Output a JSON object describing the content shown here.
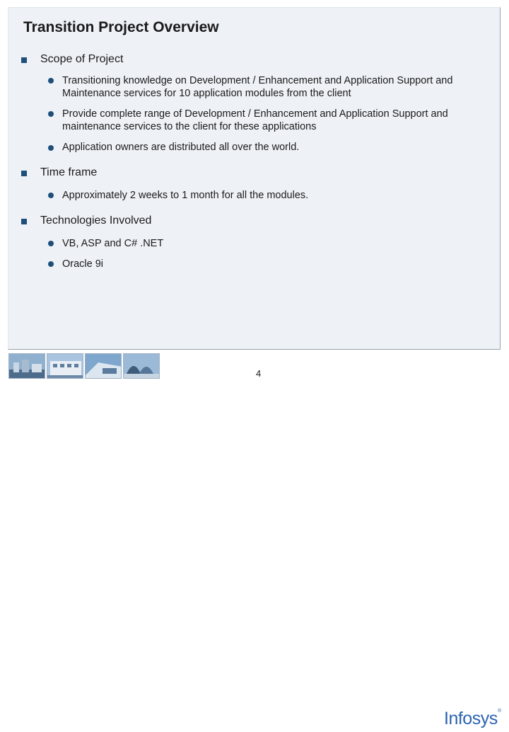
{
  "slide": {
    "title": "Transition Project Overview",
    "sections": [
      {
        "heading": "Scope of Project",
        "items": [
          "Transitioning knowledge on Development / Enhancement and Application Support and Maintenance services for 10 application modules from the client",
          "Provide complete range of Development / Enhancement and Application Support and maintenance services to the client for these applications",
          "Application owners are distributed all over the world."
        ]
      },
      {
        "heading": "Time frame",
        "items": [
          "Approximately 2 weeks to 1 month for all the modules."
        ]
      },
      {
        "heading": "Technologies Involved",
        "items": [
          "VB, ASP and C# .NET",
          "Oracle 9i"
        ]
      }
    ]
  },
  "footer": {
    "page_number": "4",
    "logo_text": "Infosys",
    "logo_mark": "®"
  },
  "colors": {
    "bullet": "#1f4e79",
    "panel": "#eef2f7",
    "logo": "#2c63b0"
  },
  "icons": [
    "square-bullet-icon",
    "round-bullet-icon",
    "building-photo-thumbnails"
  ]
}
